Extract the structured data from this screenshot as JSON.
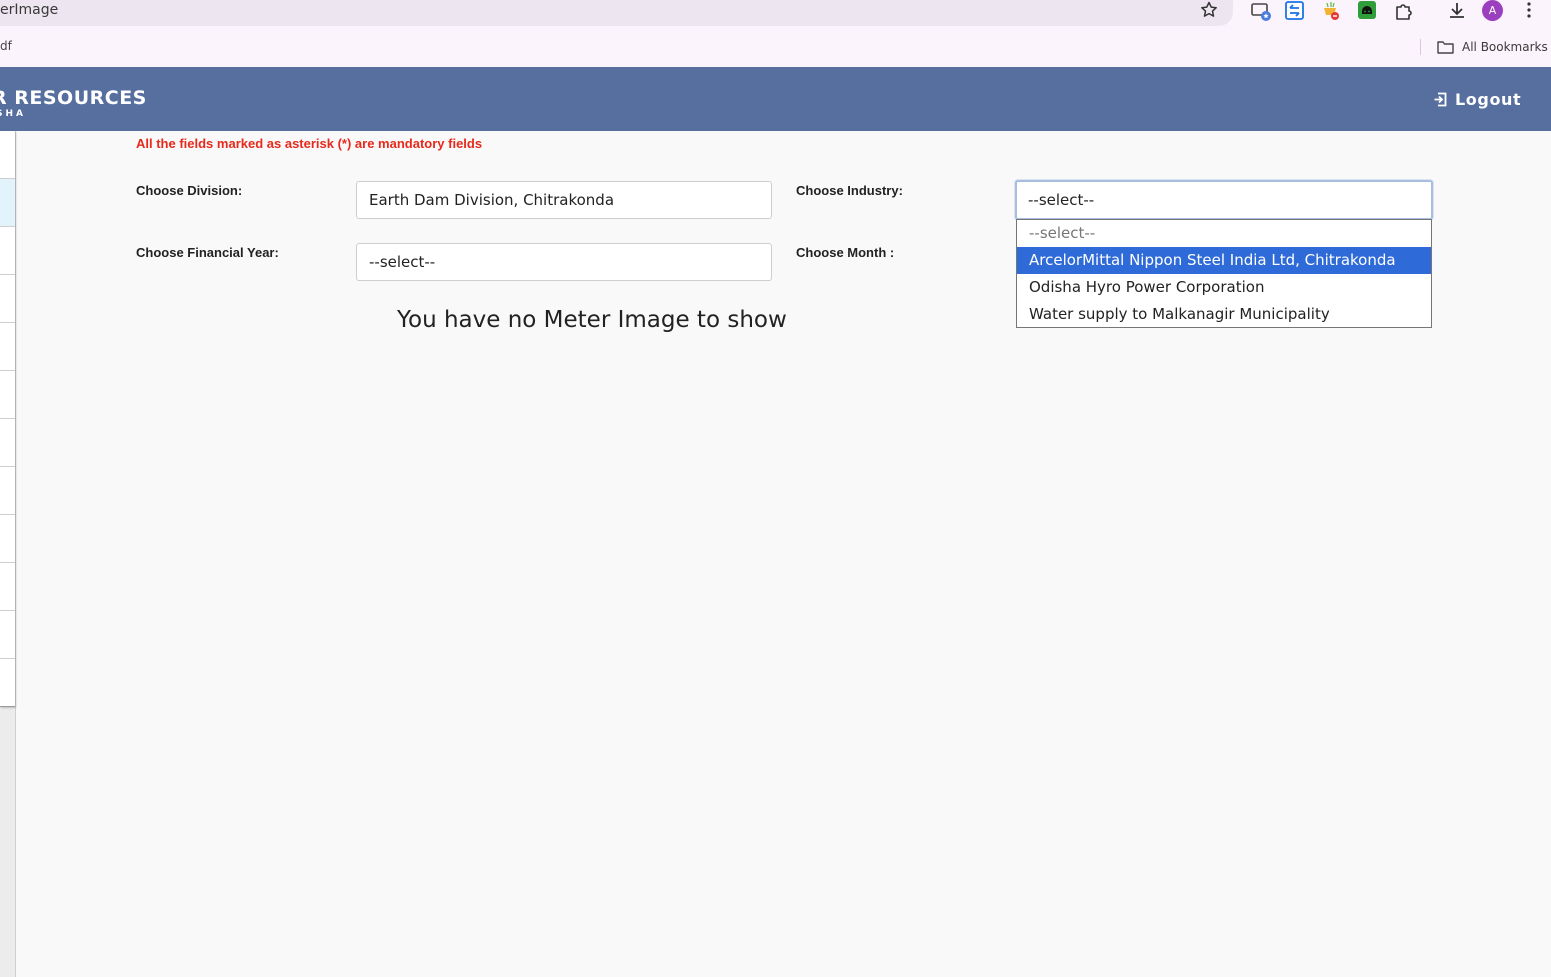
{
  "browser": {
    "url_fragment": "erImage",
    "bookmark_fragment": "df",
    "all_bookmarks_label": "All Bookmarks",
    "profile_initial": "A"
  },
  "header": {
    "brand_title": "R RESOURCES",
    "brand_subtitle": "SHA",
    "logout_label": "Logout"
  },
  "form": {
    "mandatory_note": "All the fields marked as asterisk (*) are mandatory fields",
    "division_label": "Choose Division:",
    "division_value": "Earth Dam Division, Chitrakonda",
    "industry_label": "Choose Industry:",
    "industry_value": "--select--",
    "financial_year_label": "Choose Financial Year:",
    "financial_year_value": "--select--",
    "month_label": "Choose Month :",
    "industry_options": [
      "--select--",
      "ArcelorMittal Nippon Steel India Ltd, Chitrakonda",
      "Odisha Hyro Power Corporation",
      "Water supply to Malkanagir Municipality"
    ],
    "highlighted_option": "ArcelorMittal Nippon Steel India Ltd, Chitrakonda"
  },
  "message": {
    "no_image": "You have no Meter Image to show"
  },
  "colors": {
    "header_bg": "#566f9f",
    "mandatory_text": "#e8291c",
    "option_highlight": "#2f6bd8"
  }
}
